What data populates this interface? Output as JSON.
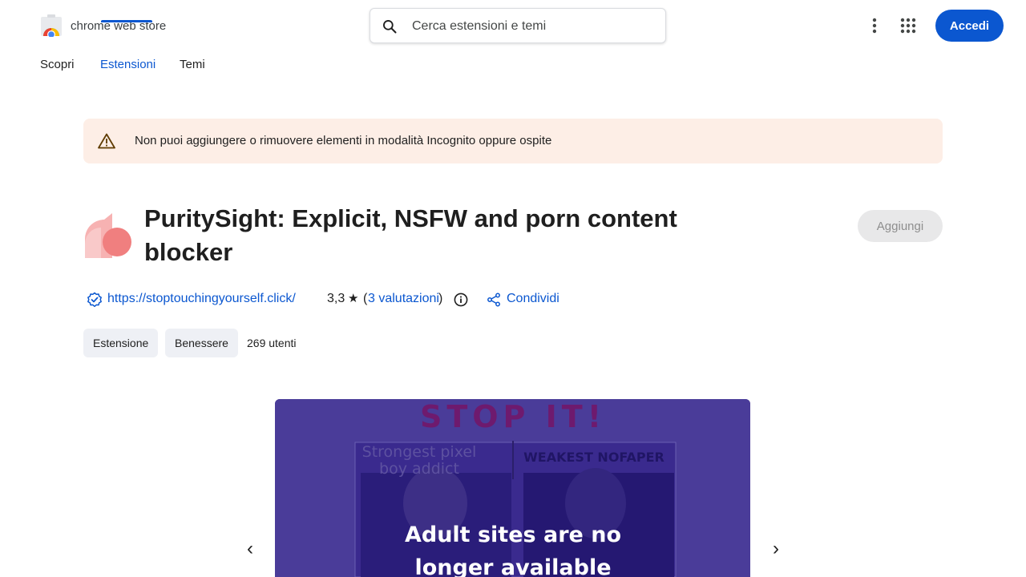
{
  "header": {
    "brand": "chrome web store",
    "search_placeholder": "Cerca estensioni e temi",
    "signin_label": "Accedi"
  },
  "nav": {
    "tabs": [
      {
        "label": "Scopri"
      },
      {
        "label": "Estensioni",
        "active": true
      },
      {
        "label": "Temi"
      }
    ]
  },
  "banner": {
    "text": "Non puoi aggiungere o rimuovere elementi in modalità Incognito oppure ospite"
  },
  "extension": {
    "title": "PuritySight: Explicit, NSFW and porn content blocker",
    "add_label": "Aggiungi",
    "website": "https://stoptouchingyourself.click/",
    "rating": "3,3",
    "ratings_link": "3 valutazioni",
    "share_label": "Condividi",
    "chips": [
      "Estensione",
      "Benessere"
    ],
    "users": "269 utenti"
  },
  "carousel": {
    "slide": {
      "heading": "STOP IT!",
      "left_caption_line1": "Strongest pixel",
      "left_caption_line2": "boy addict",
      "right_caption": "WEAKEST NOFAPER",
      "overlay_line1": "Adult sites are no",
      "overlay_line2": "longer available"
    }
  },
  "colors": {
    "accent": "#0b57d0",
    "banner_bg": "#fdeee6",
    "icon_pink": "#f28b8b"
  }
}
